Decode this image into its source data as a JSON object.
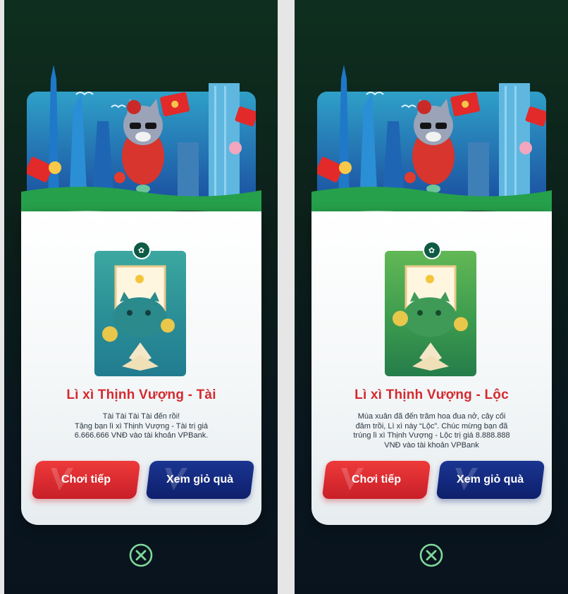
{
  "colors": {
    "title_red": "#d42a2f",
    "button_red": "#e02e32",
    "button_blue": "#142a80",
    "close_green": "#7fd89a",
    "background": "#0c1f1a"
  },
  "screens": [
    {
      "variant": "tai",
      "title": "Lì xì Thịnh Vượng - Tài",
      "description_lines": [
        "Tài Tài Tài Tài đến rồi!",
        "Tặng bạn lì xì Thịnh Vượng - Tài trị giá",
        "6.666.666 VNĐ vào tài khoản VPBank."
      ],
      "buttons": {
        "play_again": "Chơi tiếp",
        "view_basket": "Xem giỏ quà"
      },
      "icons": {
        "close": "close-circle-icon",
        "pin": "lotus-icon"
      }
    },
    {
      "variant": "loc",
      "title": "Lì xì Thịnh Vượng - Lộc",
      "description_lines": [
        "Mùa xuân đã đến trăm hoa đua nở, cây cối",
        "đâm trồi, Lì xì này “Lộc”. Chúc mừng bạn đã",
        "trúng lì xì Thịnh Vượng - Lộc trị giá 8.888.888",
        "VNĐ vào tài khoản VPBank"
      ],
      "buttons": {
        "play_again": "Chơi tiếp",
        "view_basket": "Xem giỏ quà"
      },
      "icons": {
        "close": "close-circle-icon",
        "pin": "lotus-icon"
      }
    }
  ]
}
